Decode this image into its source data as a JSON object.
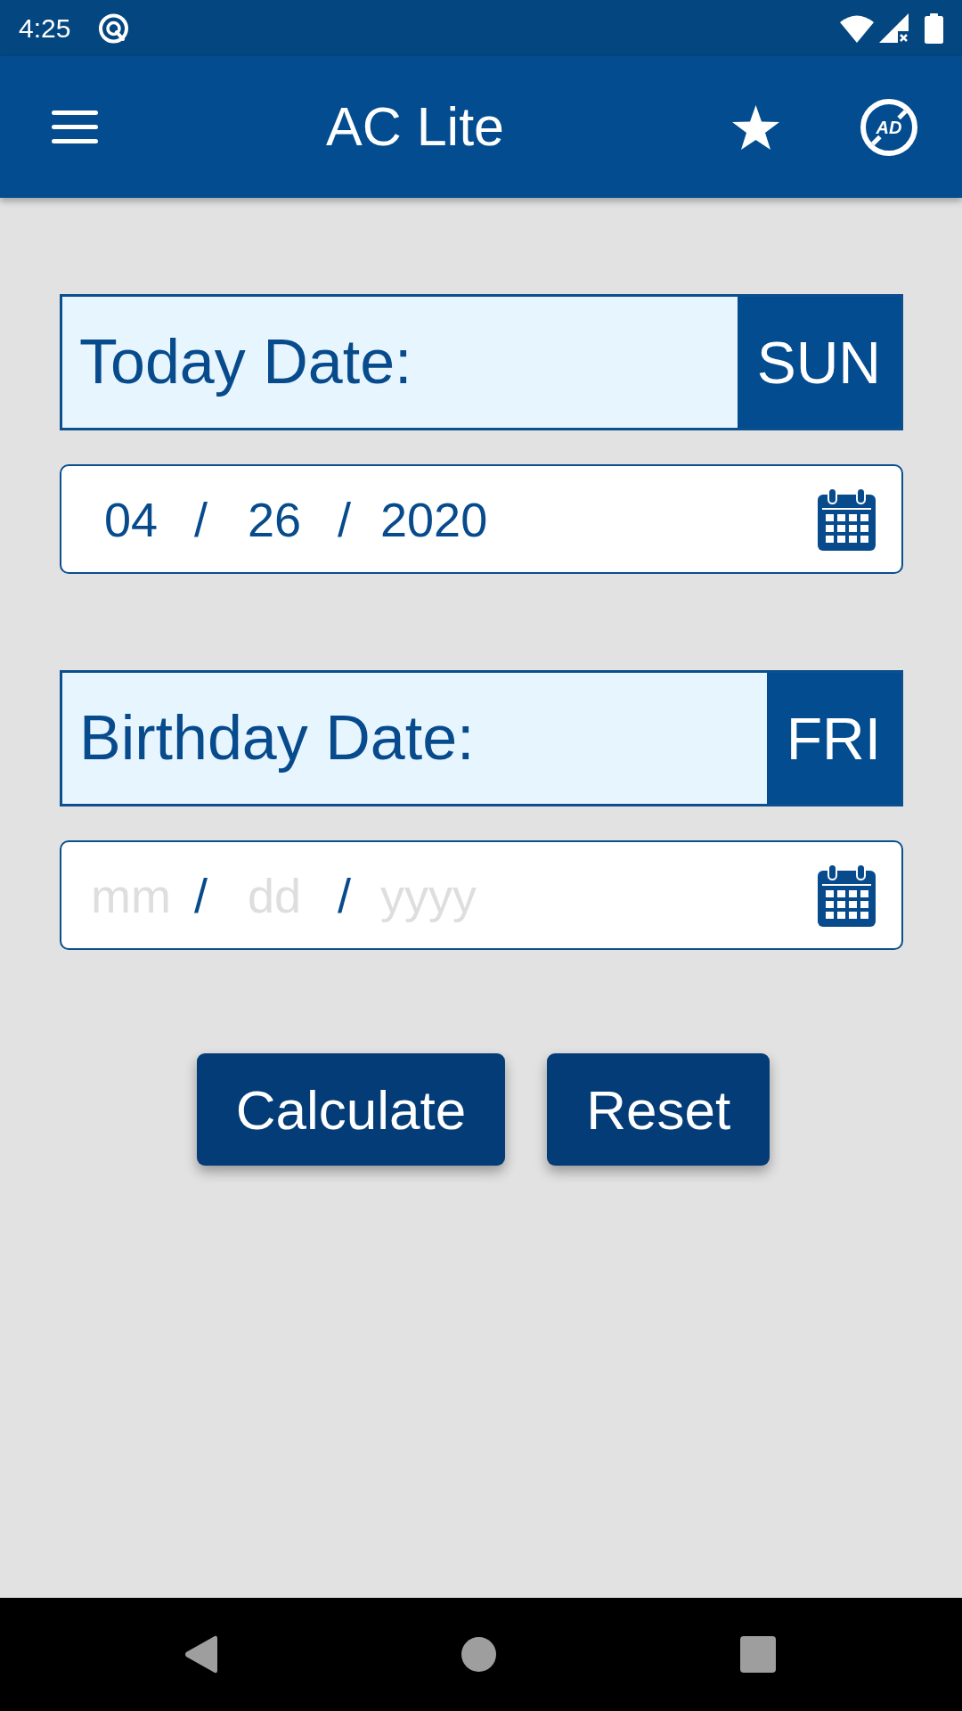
{
  "status_bar": {
    "time": "4:25"
  },
  "app_bar": {
    "title": "AC Lite",
    "ad_badge": "AD"
  },
  "date_sections": [
    {
      "label": "Today Date:",
      "weekday": "SUN",
      "date_parts": [
        {
          "kind": "month",
          "value": "04"
        },
        {
          "kind": "separator",
          "text": "/"
        },
        {
          "kind": "day",
          "value": "26"
        },
        {
          "kind": "separator",
          "text": "/"
        },
        {
          "kind": "year",
          "value": "2020"
        }
      ]
    },
    {
      "label": "Birthday Date:",
      "weekday": "FRI",
      "date_parts": [
        {
          "kind": "month",
          "placeholder": "mm"
        },
        {
          "kind": "separator",
          "text": "/"
        },
        {
          "kind": "day",
          "placeholder": "dd"
        },
        {
          "kind": "separator",
          "text": "/"
        },
        {
          "kind": "year",
          "placeholder": "yyyy"
        }
      ]
    }
  ],
  "buttons": [
    {
      "label": "Calculate"
    },
    {
      "label": "Reset"
    }
  ]
}
